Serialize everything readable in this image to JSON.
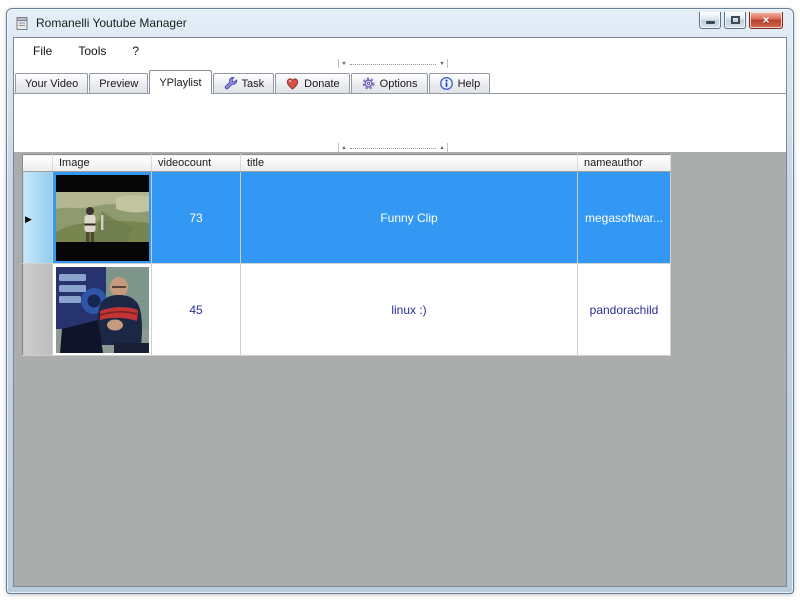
{
  "window": {
    "title": "Romanelli Youtube Manager"
  },
  "icons": {
    "close": "×",
    "row_selector": "▶",
    "collapse_down": "▼",
    "collapse_up": "▲"
  },
  "menu": {
    "items": [
      {
        "label": "File"
      },
      {
        "label": "Tools"
      },
      {
        "label": "?"
      }
    ]
  },
  "tabs": [
    {
      "label": "Your Video",
      "active": false
    },
    {
      "label": "Preview",
      "active": false
    },
    {
      "label": "YPlaylist",
      "active": true
    },
    {
      "label": "Task",
      "active": false,
      "icon": "wrench-icon"
    },
    {
      "label": "Donate",
      "active": false,
      "icon": "heart-icon"
    },
    {
      "label": "Options",
      "active": false,
      "icon": "gear-icon"
    },
    {
      "label": "Help",
      "active": false,
      "icon": "info-icon"
    }
  ],
  "grid": {
    "columns": {
      "selector": "",
      "image": "Image",
      "videocount": "videocount",
      "title": "title",
      "nameauthor": "nameauthor"
    },
    "rows": [
      {
        "selected": true,
        "thumbnail": "field-scene-video-thumbnail",
        "videocount": "73",
        "title": "Funny Clip",
        "nameauthor": "megasoftwar..."
      },
      {
        "selected": false,
        "thumbnail": "tech-show-video-thumbnail",
        "videocount": "45",
        "title": "linux :)",
        "nameauthor": "pandorachild"
      }
    ]
  },
  "colors": {
    "selected_row_bg": "#3398f4",
    "selected_row_text": "#ffffff",
    "cell_text": "#2d2d96",
    "panel_gray": "#abadac",
    "close_button_red": "#c9473a"
  }
}
